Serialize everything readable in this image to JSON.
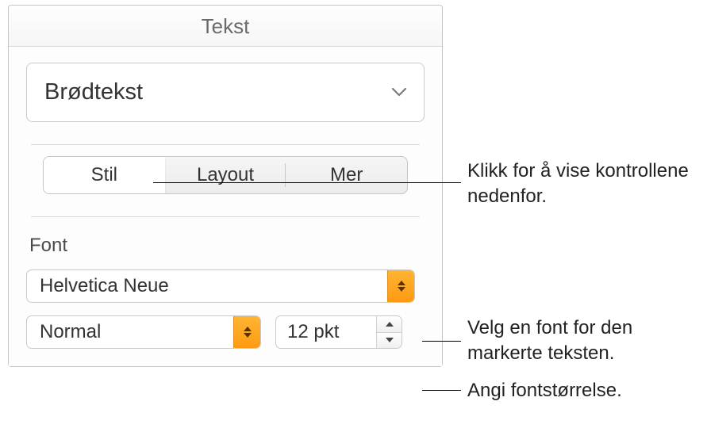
{
  "panel": {
    "title": "Tekst",
    "paragraph_style": "Brødtekst",
    "tabs": {
      "stil": "Stil",
      "layout": "Layout",
      "mer": "Mer"
    },
    "font_section_label": "Font",
    "font_family": "Helvetica Neue",
    "font_weight": "Normal",
    "font_size": "12 pkt"
  },
  "callouts": {
    "tabs": "Klikk for å vise kontrollene nedenfor.",
    "font": "Velg en font for den markerte teksten.",
    "size": "Angi fontstørrelse."
  }
}
